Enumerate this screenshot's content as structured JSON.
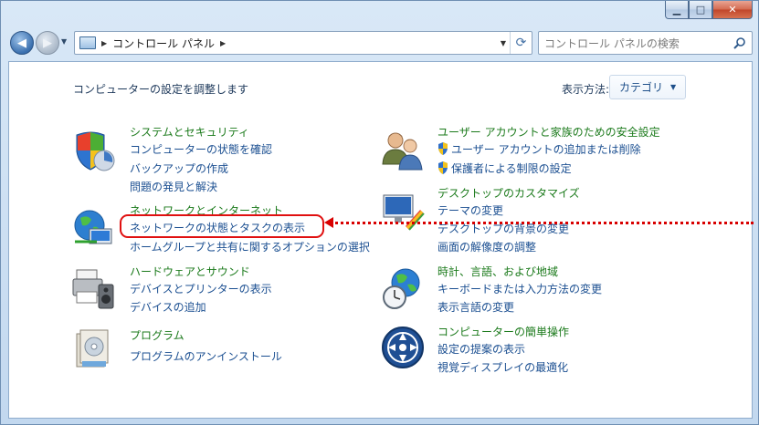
{
  "window": {
    "caption": {
      "minimize": "▁",
      "maximize": "□",
      "close": "✕"
    }
  },
  "navigation": {
    "breadcrumb": "コントロール パネル",
    "search_placeholder": "コントロール パネルの検索"
  },
  "content": {
    "heading": "コンピューターの設定を調整します",
    "view_by_label": "表示方法:",
    "view_by_value": "カテゴリ"
  },
  "categories_left": [
    {
      "title": "システムとセキュリティ",
      "links": [
        "コンピューターの状態を確認",
        "バックアップの作成",
        "問題の発見と解決"
      ]
    },
    {
      "title": "ネットワークとインターネット",
      "links": [
        "ネットワークの状態とタスクの表示",
        "ホームグループと共有に関するオプションの選択"
      ]
    },
    {
      "title": "ハードウェアとサウンド",
      "links": [
        "デバイスとプリンターの表示",
        "デバイスの追加"
      ]
    },
    {
      "title": "プログラム",
      "links": [
        "プログラムのアンインストール"
      ]
    }
  ],
  "categories_right": [
    {
      "title": "ユーザー アカウントと家族のための安全設定",
      "links": [
        "ユーザー アカウントの追加または削除",
        "保護者による制限の設定"
      ]
    },
    {
      "title": "デスクトップのカスタマイズ",
      "links": [
        "テーマの変更",
        "デスクトップの背景の変更",
        "画面の解像度の調整"
      ]
    },
    {
      "title": "時計、言語、および地域",
      "links": [
        "キーボードまたは入力方法の変更",
        "表示言語の変更"
      ]
    },
    {
      "title": "コンピューターの簡単操作",
      "links": [
        "設定の提案の表示",
        "視覚ディスプレイの最適化"
      ]
    }
  ],
  "colors": {
    "category_title": "#1b7a1b",
    "link": "#1b4f91",
    "annotation": "#e01010"
  }
}
